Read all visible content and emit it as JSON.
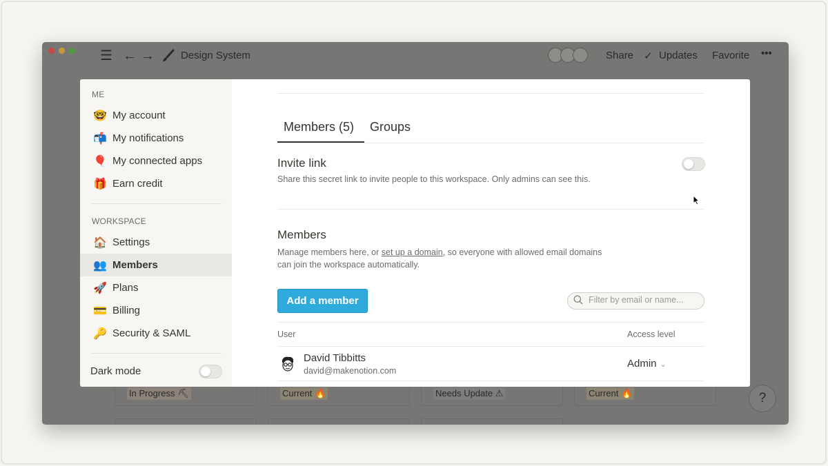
{
  "window": {
    "title": "Design System",
    "title_icon": "paintbrush-icon",
    "actions": {
      "share": "Share",
      "updates": "Updates",
      "favorite": "Favorite",
      "more": "•••"
    }
  },
  "background_tags": [
    "In Progress ⛏",
    "Current 🔥",
    "Needs Update ⚠",
    "Current 🔥"
  ],
  "help": "?",
  "sidebar": {
    "me_section": "ME",
    "me_items": [
      {
        "label": "My account",
        "icon": "🤓"
      },
      {
        "label": "My notifications",
        "icon": "📬"
      },
      {
        "label": "My connected apps",
        "icon": "🎈"
      },
      {
        "label": "Earn credit",
        "icon": "🎁"
      }
    ],
    "workspace_section": "WORKSPACE",
    "workspace_items": [
      {
        "label": "Settings",
        "icon": "🏠"
      },
      {
        "label": "Members",
        "icon": "👥"
      },
      {
        "label": "Plans",
        "icon": "🚀"
      },
      {
        "label": "Billing",
        "icon": "💳"
      },
      {
        "label": "Security & SAML",
        "icon": "🔑"
      }
    ],
    "dark_mode_label": "Dark mode",
    "dark_mode_on": false
  },
  "content": {
    "tabs": [
      "Members (5)",
      "Groups"
    ],
    "active_tab": 0,
    "invite": {
      "title": "Invite link",
      "description": "Share this secret link to invite people to this workspace. Only admins can see this.",
      "enabled": false
    },
    "members": {
      "title": "Members",
      "desc_prefix": "Manage members here, or ",
      "desc_link": "set up a domain",
      "desc_suffix": ", so everyone with allowed email domains",
      "desc_line2": "can join the workspace automatically.",
      "add_button": "Add a member",
      "filter_placeholder": "Filter by email or name..."
    },
    "table": {
      "col_user": "User",
      "col_access": "Access level",
      "rows": [
        {
          "name": "David Tibbitts",
          "email": "david@makenotion.com",
          "access": "Admin"
        }
      ]
    }
  }
}
